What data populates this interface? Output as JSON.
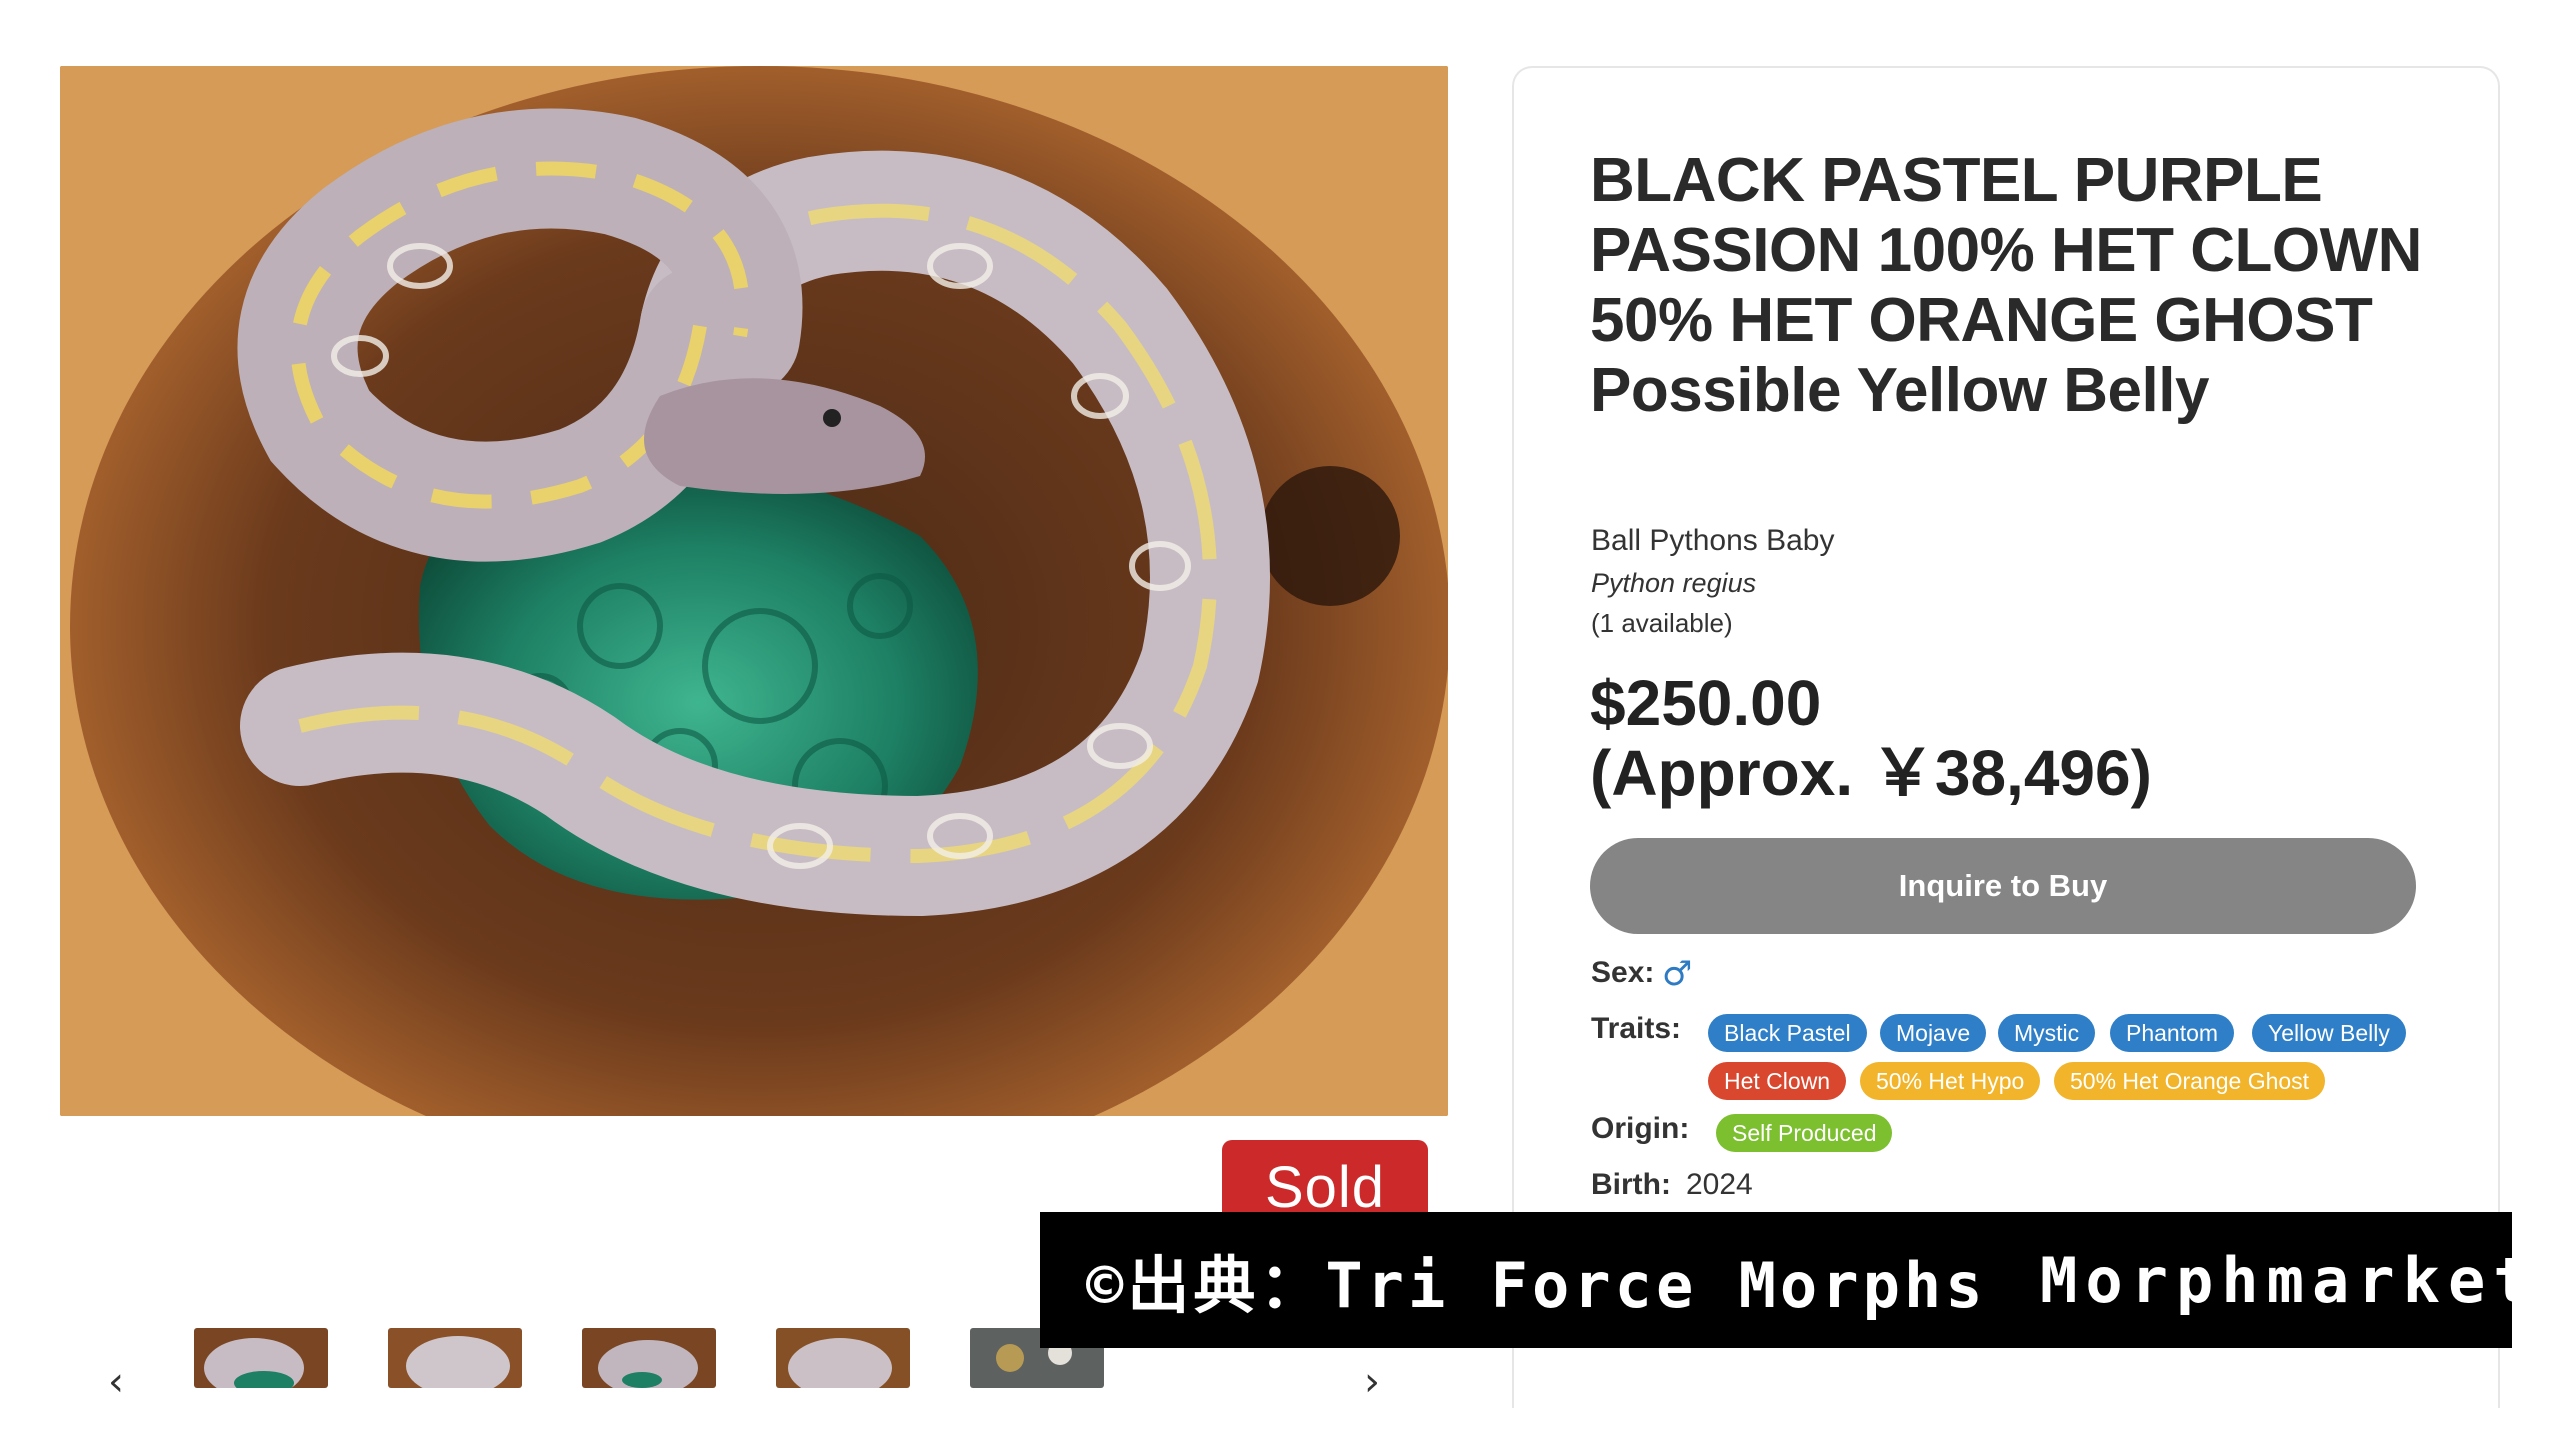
{
  "product": {
    "title": "BLACK PASTEL PURPLE PASSION 100% HET CLOWN 50% HET ORANGE GHOST Possible Yellow Belly",
    "category": "Ball Pythons Baby",
    "species": "Python regius",
    "availability": "(1 available)",
    "price_line1": "$250.00",
    "price_line2": "(Approx. ￥38,496)",
    "inquire_label": "Inquire to Buy",
    "status_badge": "Sold"
  },
  "fields": {
    "sex_label": "Sex:",
    "sex_icon": "male-icon",
    "sex_glyph": "♂",
    "traits_label": "Traits:",
    "origin_label": "Origin:",
    "birth_label": "Birth:",
    "birth_value": "2024"
  },
  "traits": [
    {
      "label": "Black Pastel",
      "color": "#2f7fc8"
    },
    {
      "label": "Mojave",
      "color": "#2f7fc8"
    },
    {
      "label": "Mystic",
      "color": "#2f7fc8"
    },
    {
      "label": "Phantom",
      "color": "#2f7fc8"
    },
    {
      "label": "Yellow Belly",
      "color": "#2f7fc8"
    },
    {
      "label": "Het Clown",
      "color": "#d9472f"
    },
    {
      "label": "50% Het Hypo",
      "color": "#f1b42a"
    },
    {
      "label": "50% Het Orange Ghost",
      "color": "#f1b42a"
    }
  ],
  "origin": {
    "label": "Self Produced",
    "color": "#7cbf2f"
  },
  "gallery": {
    "prev_icon": "chevron-left-icon",
    "next_icon": "chevron-right-icon",
    "prev_glyph": "‹",
    "next_glyph": "›",
    "thumbnail_count": 5
  },
  "watermark": {
    "left": "©出典：Tri Force Morphs",
    "right": "Morphmarket"
  },
  "colors": {
    "sold_red": "#cc2a2a",
    "button_gray": "#858585",
    "trait_blue": "#2f7fc8",
    "trait_red": "#d9472f",
    "trait_yellow": "#f1b42a",
    "origin_green": "#7cbf2f"
  }
}
